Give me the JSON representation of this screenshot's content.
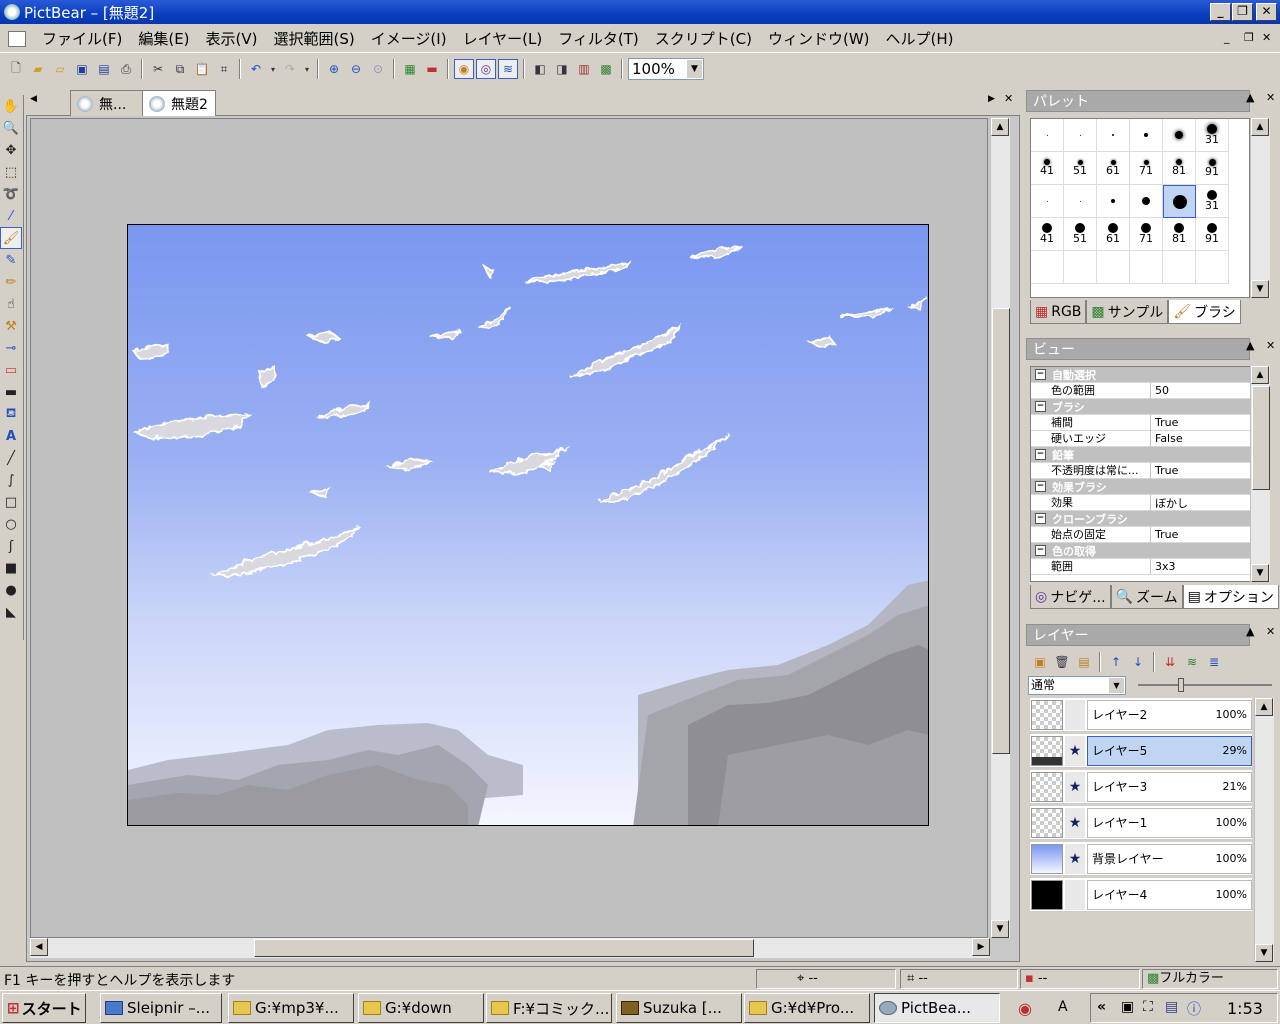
{
  "window": {
    "title": "PictBear – [無題2]",
    "min": "_",
    "max": "❐",
    "close": "✕"
  },
  "menu": {
    "items": [
      "ファイル(F)",
      "編集(E)",
      "表示(V)",
      "選択範囲(S)",
      "イメージ(I)",
      "レイヤー(L)",
      "フィルタ(T)",
      "スクリプト(C)",
      "ウィンドウ(W)",
      "ヘルプ(H)"
    ]
  },
  "toolbar": {
    "zoom": "100%"
  },
  "tabs": [
    {
      "label": "無..."
    },
    {
      "label": "無題2"
    }
  ],
  "palette": {
    "title": "パレット",
    "brush_labels": [
      "",
      "",
      "",
      "",
      "",
      "31",
      "41",
      "51",
      "61",
      "71",
      "81",
      "91",
      "",
      "",
      "",
      "",
      "",
      "31",
      "41",
      "51",
      "61",
      "71",
      "81",
      "91"
    ],
    "tabs": [
      "RGB",
      "サンプル",
      "ブラシ"
    ]
  },
  "view": {
    "title": "ビュー",
    "rows": [
      {
        "type": "cat",
        "key": "自動選択"
      },
      {
        "type": "prop",
        "key": "色の範囲",
        "value": "50"
      },
      {
        "type": "cat",
        "key": "ブラシ"
      },
      {
        "type": "prop",
        "key": "補間",
        "value": "True"
      },
      {
        "type": "prop",
        "key": "硬いエッジ",
        "value": "False"
      },
      {
        "type": "cat",
        "key": "鉛筆"
      },
      {
        "type": "prop",
        "key": "不透明度は常に...",
        "value": "True"
      },
      {
        "type": "cat",
        "key": "効果ブラシ"
      },
      {
        "type": "prop",
        "key": "効果",
        "value": "ぼかし"
      },
      {
        "type": "cat",
        "key": "クローンブラシ"
      },
      {
        "type": "prop",
        "key": "始点の固定",
        "value": "True"
      },
      {
        "type": "cat",
        "key": "色の取得"
      },
      {
        "type": "prop",
        "key": "範囲",
        "value": "3x3"
      }
    ],
    "tabs": [
      "ナビゲ...",
      "ズーム",
      "オプション"
    ]
  },
  "layers": {
    "title": "レイヤー",
    "blend_mode": "通常",
    "opacity_slider": 0.3,
    "items": [
      {
        "name": "レイヤー2",
        "opacity": "100%",
        "visible": false,
        "selected": false,
        "thumb": "checker"
      },
      {
        "name": "レイヤー5",
        "opacity": "29%",
        "visible": true,
        "selected": true,
        "thumb": "checker-dark"
      },
      {
        "name": "レイヤー3",
        "opacity": "21%",
        "visible": true,
        "selected": false,
        "thumb": "checker"
      },
      {
        "name": "レイヤー1",
        "opacity": "100%",
        "visible": true,
        "selected": false,
        "thumb": "checker"
      },
      {
        "name": "背景レイヤー",
        "opacity": "100%",
        "visible": true,
        "selected": false,
        "thumb": "sky"
      },
      {
        "name": "レイヤー4",
        "opacity": "100%",
        "visible": false,
        "selected": false,
        "thumb": "black"
      }
    ]
  },
  "status": {
    "help": "F1 キーを押すとヘルプを表示します",
    "pos": "--",
    "size": "--",
    "color_pos": "--",
    "color_mode": "フルカラー"
  },
  "taskbar": {
    "start": "スタート",
    "buttons": [
      "Sleipnir –...",
      "G:¥mp3¥...",
      "G:¥down",
      "F:¥コミック...",
      "Suzuka [...",
      "G:¥d¥Pro...",
      "PictBea..."
    ],
    "clock": "1:53"
  }
}
